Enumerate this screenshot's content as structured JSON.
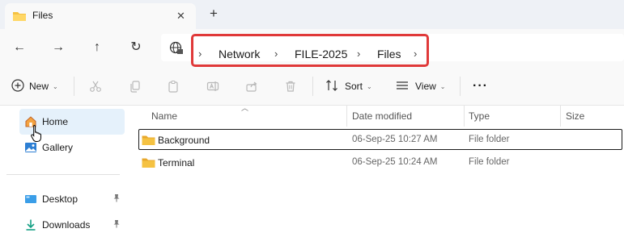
{
  "tab": {
    "title": "Files",
    "close_glyph": "✕",
    "icon": "folder-icon"
  },
  "newtab": {
    "glyph": "+"
  },
  "nav": {
    "back": "←",
    "forward": "→",
    "up": "↑",
    "refresh": "↻"
  },
  "address": {
    "icon": "network-icon",
    "crumbs": [
      "Network",
      "FILE-2025",
      "Files"
    ],
    "chevron": "›",
    "highlight_color": "#e03939"
  },
  "commands": {
    "new": "New",
    "sort": "Sort",
    "view": "View",
    "more": "···",
    "disabled_icons": [
      "cut-icon",
      "copy-icon",
      "paste-icon",
      "rename-icon",
      "share-icon",
      "delete-icon"
    ]
  },
  "sidebar": {
    "items": [
      {
        "label": "Home",
        "icon": "home-icon",
        "selected": true
      },
      {
        "label": "Gallery",
        "icon": "gallery-icon"
      },
      {
        "label": "Desktop",
        "icon": "desktop-icon",
        "pinned": true
      },
      {
        "label": "Downloads",
        "icon": "downloads-icon",
        "pinned": true
      }
    ],
    "pin_glyph": "📌"
  },
  "columns": {
    "name": "Name",
    "date": "Date modified",
    "type": "Type",
    "size": "Size"
  },
  "files": [
    {
      "name": "Background",
      "date": "06-Sep-25 10:27 AM",
      "type": "File folder",
      "focused": true
    },
    {
      "name": "Terminal",
      "date": "06-Sep-25 10:24 AM",
      "type": "File folder"
    }
  ],
  "colors": {
    "folder": "#f5c242",
    "selection": "#e5f1fb",
    "accent": "#0067c0"
  }
}
